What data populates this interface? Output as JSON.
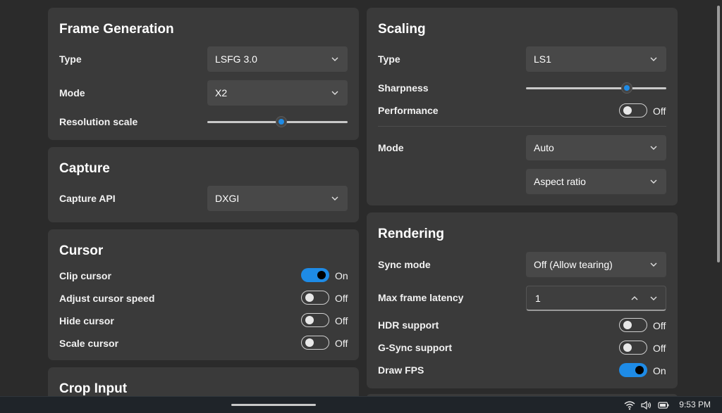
{
  "frame_generation": {
    "title": "Frame Generation",
    "type_label": "Type",
    "type_value": "LSFG 3.0",
    "mode_label": "Mode",
    "mode_value": "X2",
    "resolution_scale_label": "Resolution scale",
    "resolution_scale_fraction": 0.53
  },
  "capture": {
    "title": "Capture",
    "api_label": "Capture API",
    "api_value": "DXGI"
  },
  "cursor": {
    "title": "Cursor",
    "clip_label": "Clip cursor",
    "clip_state": "On",
    "adjust_speed_label": "Adjust cursor speed",
    "adjust_speed_state": "Off",
    "hide_label": "Hide cursor",
    "hide_state": "Off",
    "scale_label": "Scale cursor",
    "scale_state": "Off"
  },
  "crop_input": {
    "title": "Crop Input"
  },
  "scaling": {
    "title": "Scaling",
    "type_label": "Type",
    "type_value": "LS1",
    "sharpness_label": "Sharpness",
    "sharpness_fraction": 0.72,
    "performance_label": "Performance",
    "performance_state": "Off",
    "mode_label": "Mode",
    "mode_value": "Auto",
    "aspect_value": "Aspect ratio"
  },
  "rendering": {
    "title": "Rendering",
    "sync_mode_label": "Sync mode",
    "sync_mode_value": "Off (Allow tearing)",
    "max_latency_label": "Max frame latency",
    "max_latency_value": "1",
    "hdr_label": "HDR support",
    "hdr_state": "Off",
    "gsync_label": "G-Sync support",
    "gsync_state": "Off",
    "draw_fps_label": "Draw FPS",
    "draw_fps_state": "On"
  },
  "taskbar": {
    "time": "9:53 PM",
    "icons": [
      "wifi-icon",
      "volume-icon",
      "battery-icon"
    ]
  },
  "colors": {
    "accent": "#1e8be6",
    "card": "#3a3a3a",
    "background": "#2b2b2b"
  }
}
